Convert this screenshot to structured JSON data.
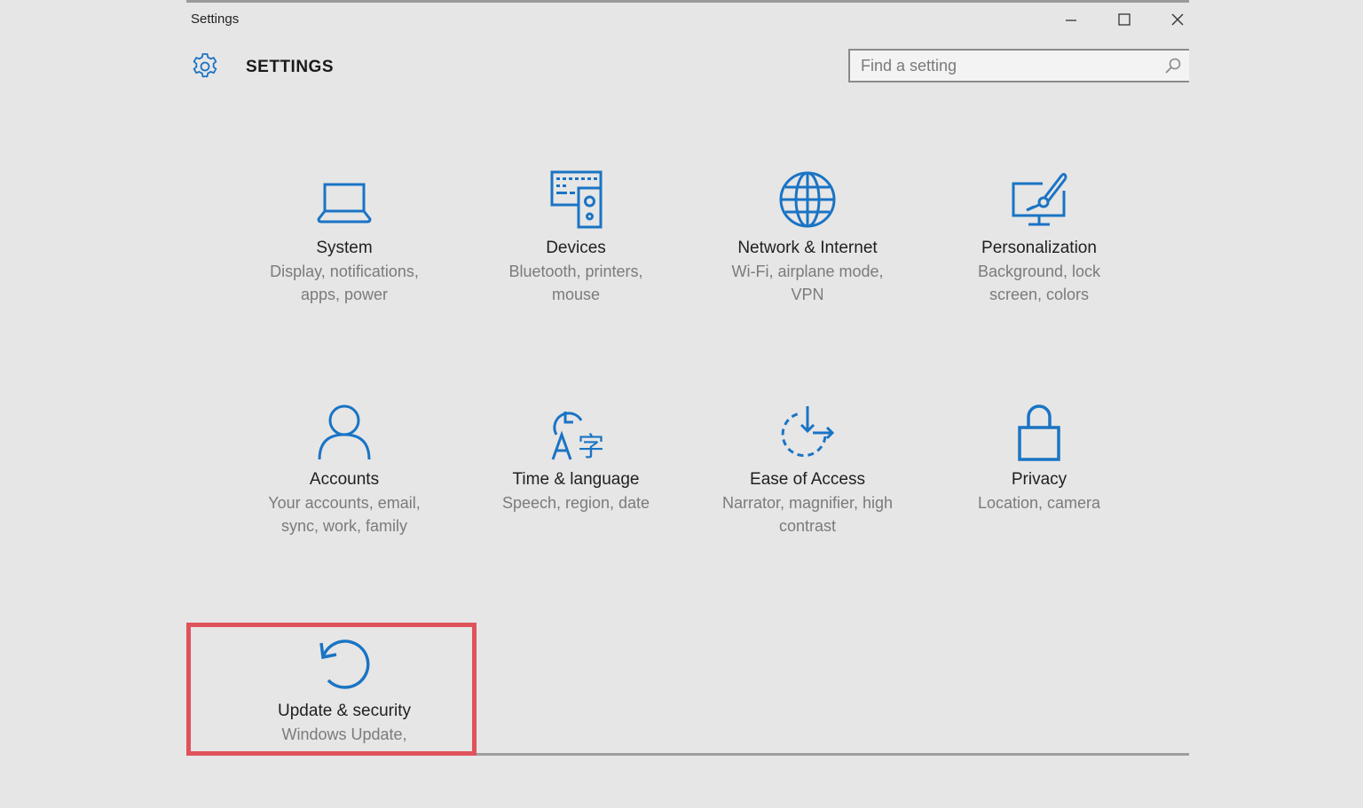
{
  "window": {
    "title": "Settings",
    "controls": {
      "minimize": "minimize",
      "maximize": "maximize",
      "close": "close"
    }
  },
  "header": {
    "title": "SETTINGS",
    "icon": "gear-icon"
  },
  "search": {
    "placeholder": "Find a setting",
    "value": "",
    "icon": "search-icon"
  },
  "accent_color": "#1a74c4",
  "highlight_color": "#e0535b",
  "categories": [
    {
      "label": "System",
      "description": "Display, notifications, apps, power",
      "icon": "laptop-icon"
    },
    {
      "label": "Devices",
      "description": "Bluetooth, printers, mouse",
      "icon": "devices-icon"
    },
    {
      "label": "Network & Internet",
      "description": "Wi-Fi, airplane mode, VPN",
      "icon": "globe-icon"
    },
    {
      "label": "Personalization",
      "description": "Background, lock screen, colors",
      "icon": "paintbrush-monitor-icon"
    },
    {
      "label": "Accounts",
      "description": "Your accounts, email, sync, work, family",
      "icon": "person-icon"
    },
    {
      "label": "Time & language",
      "description": "Speech, region, date",
      "icon": "time-language-icon"
    },
    {
      "label": "Ease of Access",
      "description": "Narrator, magnifier, high contrast",
      "icon": "ease-of-access-icon"
    },
    {
      "label": "Privacy",
      "description": "Location, camera",
      "icon": "lock-icon"
    },
    {
      "label": "Update & security",
      "description": "Windows Update,",
      "icon": "refresh-icon",
      "highlighted": true
    }
  ]
}
